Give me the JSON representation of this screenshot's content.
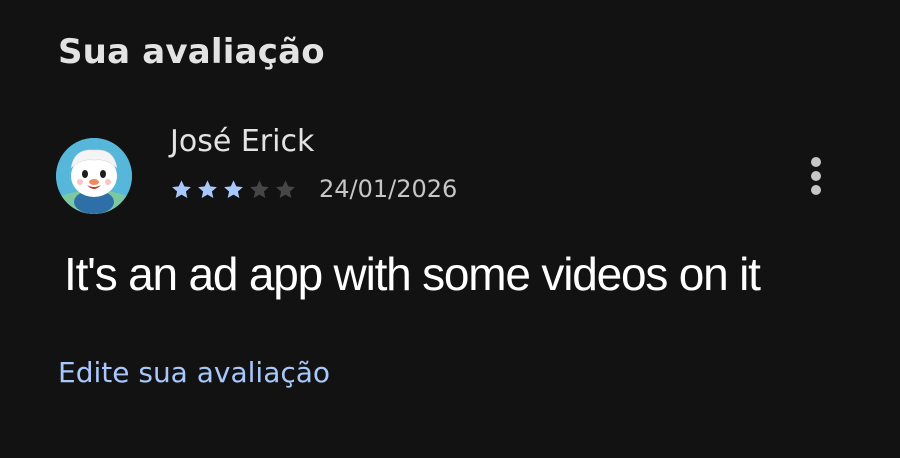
{
  "section": {
    "title": "Sua avaliação"
  },
  "review": {
    "avatar_icon": "pokemon-oshawott-avatar",
    "author": "José Erick",
    "rating": 3,
    "max_rating": 5,
    "date": "24/01/2026",
    "text": "It's an ad app with some videos on it",
    "more_icon": "more-vert-icon"
  },
  "actions": {
    "edit_label": "Edite sua avaliação"
  },
  "colors": {
    "background": "#121213",
    "star_filled": "#a8c7fa",
    "star_empty": "#444746",
    "link": "#a8c7fa"
  }
}
